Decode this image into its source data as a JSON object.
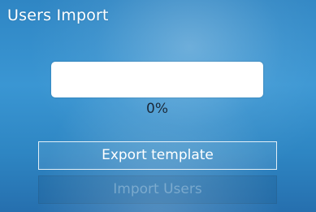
{
  "window": {
    "title": "Users Import"
  },
  "progress": {
    "value": 0,
    "text": "0%"
  },
  "buttons": {
    "export_label": "Export template",
    "import_label": "Import Users"
  },
  "colors": {
    "background": "#3a96d3",
    "progress_track": "#ffffff",
    "text_primary": "#ffffff",
    "disabled_text": "#78aacd"
  }
}
